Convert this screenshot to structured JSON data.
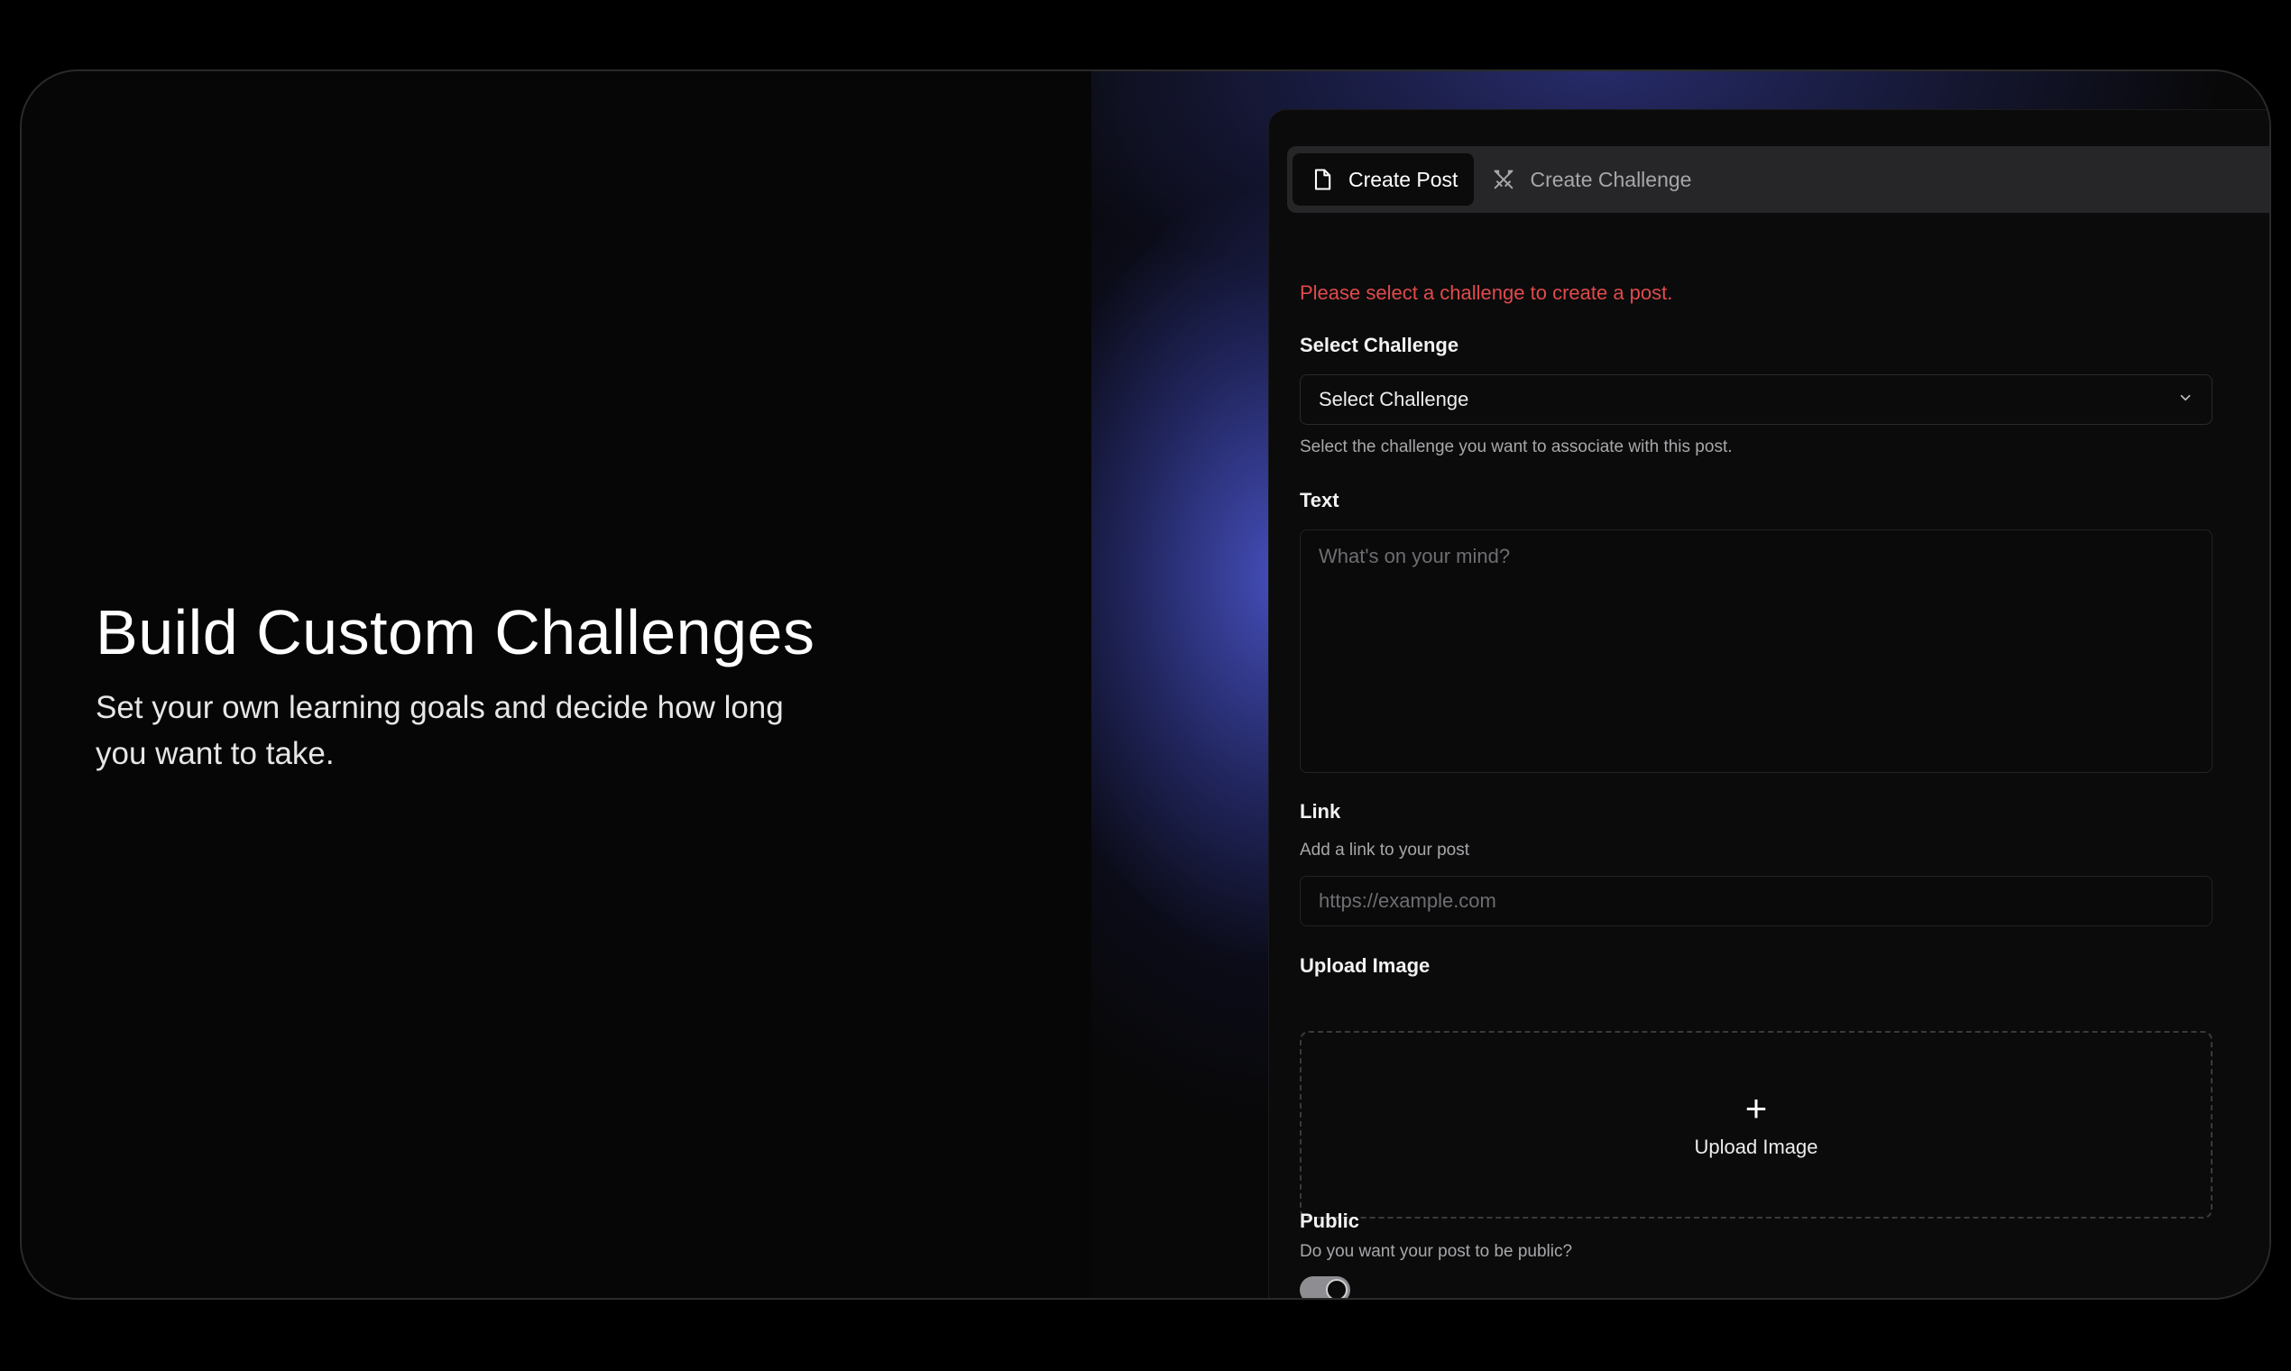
{
  "hero": {
    "title": "Build Custom Challenges",
    "subtitle": "Set your own learning goals and decide how long you want to take."
  },
  "tabs": [
    {
      "label": "Create Post",
      "icon": "document-icon",
      "active": true
    },
    {
      "label": "Create Challenge",
      "icon": "crossed-swords-icon",
      "active": false
    }
  ],
  "form": {
    "error": "Please select a challenge to create a post.",
    "challenge": {
      "label": "Select Challenge",
      "value": "Select Challenge",
      "help": "Select the challenge you want to associate with this post."
    },
    "text": {
      "label": "Text",
      "placeholder": "What's on your mind?"
    },
    "link": {
      "label": "Link",
      "help": "Add a link to your post",
      "placeholder": "https://example.com"
    },
    "upload": {
      "label": "Upload Image",
      "button_label": "Upload Image"
    },
    "public": {
      "label": "Public",
      "help": "Do you want your post to be public?",
      "enabled": true
    }
  },
  "colors": {
    "background": "#000000",
    "frame": "#060606",
    "panel": "#0b0b0c",
    "accent_glow": "#4852c4",
    "error": "#e14a4a"
  }
}
